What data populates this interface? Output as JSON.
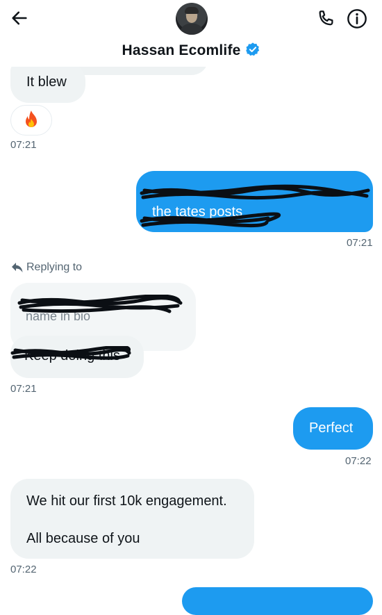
{
  "header": {
    "contact_name": "Hassan Ecomlife",
    "back_icon": "arrow-left-icon",
    "call_icon": "phone-icon",
    "info_icon": "info-icon",
    "verified_color": "#1d9bf0"
  },
  "messages": {
    "m1_text": "It blew",
    "m1_reaction_icon": "fire-emoji-icon",
    "m1_time": "07:21",
    "m2_text": "the tates posts",
    "m2_time": "07:21",
    "reply_label": "Replying to",
    "m3_visible_text": "name in bio",
    "m4_visible_text": "Keep doing this",
    "m4_time": "07:21",
    "m5_text": "Perfect",
    "m5_time": "07:22",
    "m6_line1": "We hit our first 10k engagement.",
    "m6_line2": "All because of you",
    "m6_time": "07:22"
  },
  "colors": {
    "accent": "#1d9bf0",
    "incoming_bubble": "#eff3f4",
    "timestamp": "#536471"
  }
}
